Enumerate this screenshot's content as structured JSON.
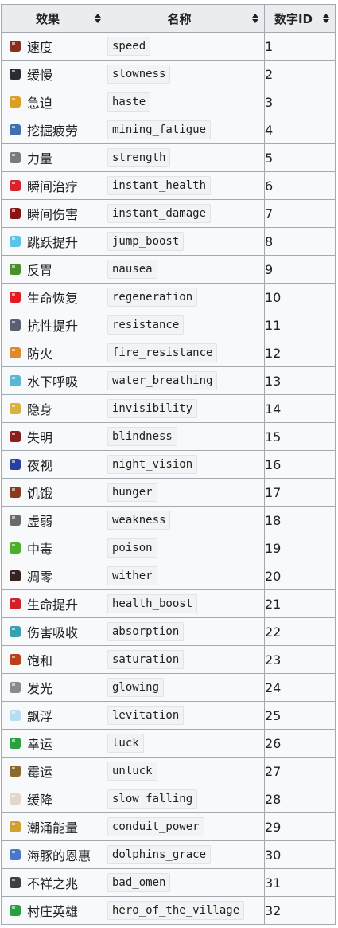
{
  "table": {
    "headers": [
      "效果",
      "名称",
      "数字ID"
    ],
    "rows": [
      {
        "effect": "速度",
        "name": "speed",
        "id": "1",
        "icon": "speed-icon",
        "color": "#8a2e1e"
      },
      {
        "effect": "缓慢",
        "name": "slowness",
        "id": "2",
        "icon": "slowness-icon",
        "color": "#2b2b33"
      },
      {
        "effect": "急迫",
        "name": "haste",
        "id": "3",
        "icon": "haste-icon",
        "color": "#d9a023"
      },
      {
        "effect": "挖掘疲劳",
        "name": "mining_fatigue",
        "id": "4",
        "icon": "mining-fatigue-icon",
        "color": "#3f6fb0"
      },
      {
        "effect": "力量",
        "name": "strength",
        "id": "5",
        "icon": "strength-icon",
        "color": "#7a7a7a"
      },
      {
        "effect": "瞬间治疗",
        "name": "instant_health",
        "id": "6",
        "icon": "instant-health-icon",
        "color": "#d8232a"
      },
      {
        "effect": "瞬间伤害",
        "name": "instant_damage",
        "id": "7",
        "icon": "instant-damage-icon",
        "color": "#8a1414"
      },
      {
        "effect": "跳跃提升",
        "name": "jump_boost",
        "id": "8",
        "icon": "jump-boost-icon",
        "color": "#5cc3e8"
      },
      {
        "effect": "反胃",
        "name": "nausea",
        "id": "9",
        "icon": "nausea-icon",
        "color": "#4a8f2a"
      },
      {
        "effect": "生命恢复",
        "name": "regeneration",
        "id": "10",
        "icon": "regeneration-icon",
        "color": "#e01b24"
      },
      {
        "effect": "抗性提升",
        "name": "resistance",
        "id": "11",
        "icon": "resistance-icon",
        "color": "#5a6070"
      },
      {
        "effect": "防火",
        "name": "fire_resistance",
        "id": "12",
        "icon": "fire-resistance-icon",
        "color": "#e0892a"
      },
      {
        "effect": "水下呼吸",
        "name": "water_breathing",
        "id": "13",
        "icon": "water-breathing-icon",
        "color": "#59b6d6"
      },
      {
        "effect": "隐身",
        "name": "invisibility",
        "id": "14",
        "icon": "invisibility-icon",
        "color": "#d8b23c"
      },
      {
        "effect": "失明",
        "name": "blindness",
        "id": "15",
        "icon": "blindness-icon",
        "color": "#8a1e1e"
      },
      {
        "effect": "夜视",
        "name": "night_vision",
        "id": "16",
        "icon": "night-vision-icon",
        "color": "#2a3fa0"
      },
      {
        "effect": "饥饿",
        "name": "hunger",
        "id": "17",
        "icon": "hunger-icon",
        "color": "#8a3a1a"
      },
      {
        "effect": "虚弱",
        "name": "weakness",
        "id": "18",
        "icon": "weakness-icon",
        "color": "#6a6a6a"
      },
      {
        "effect": "中毒",
        "name": "poison",
        "id": "19",
        "icon": "poison-icon",
        "color": "#4caf2a"
      },
      {
        "effect": "凋零",
        "name": "wither",
        "id": "20",
        "icon": "wither-icon",
        "color": "#3a2020"
      },
      {
        "effect": "生命提升",
        "name": "health_boost",
        "id": "21",
        "icon": "health-boost-icon",
        "color": "#d0202a"
      },
      {
        "effect": "伤害吸收",
        "name": "absorption",
        "id": "22",
        "icon": "absorption-icon",
        "color": "#3aa0b0"
      },
      {
        "effect": "饱和",
        "name": "saturation",
        "id": "23",
        "icon": "saturation-icon",
        "color": "#b8401a"
      },
      {
        "effect": "发光",
        "name": "glowing",
        "id": "24",
        "icon": "glowing-icon",
        "color": "#8a8a8a"
      },
      {
        "effect": "飘浮",
        "name": "levitation",
        "id": "25",
        "icon": "levitation-icon",
        "color": "#b8dcf0"
      },
      {
        "effect": "幸运",
        "name": "luck",
        "id": "26",
        "icon": "luck-icon",
        "color": "#2aa040"
      },
      {
        "effect": "霉运",
        "name": "unluck",
        "id": "27",
        "icon": "unluck-icon",
        "color": "#8a6a2a"
      },
      {
        "effect": "缓降",
        "name": "slow_falling",
        "id": "28",
        "icon": "slow-falling-icon",
        "color": "#e0d8c8"
      },
      {
        "effect": "潮涌能量",
        "name": "conduit_power",
        "id": "29",
        "icon": "conduit-power-icon",
        "color": "#d0a030"
      },
      {
        "effect": "海豚的恩惠",
        "name": "dolphins_grace",
        "id": "30",
        "icon": "dolphins-grace-icon",
        "color": "#4a78c8"
      },
      {
        "effect": "不祥之兆",
        "name": "bad_omen",
        "id": "31",
        "icon": "bad-omen-icon",
        "color": "#404040"
      },
      {
        "effect": "村庄英雄",
        "name": "hero_of_the_village",
        "id": "32",
        "icon": "hero-of-the-village-icon",
        "color": "#2aa040"
      }
    ]
  }
}
